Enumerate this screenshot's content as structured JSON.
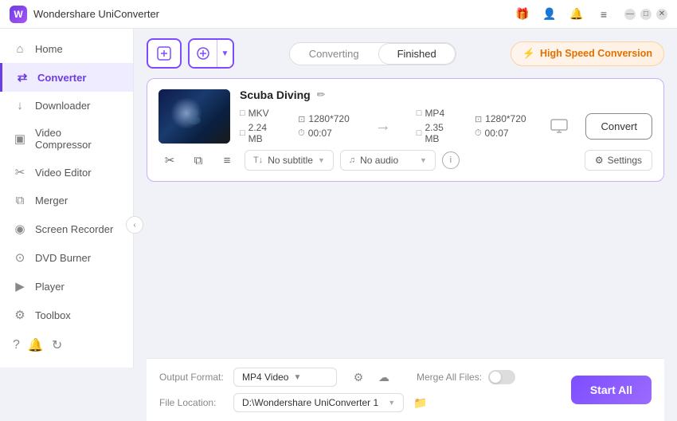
{
  "app": {
    "title": "Wondershare UniConverter",
    "logo_text": "W"
  },
  "titlebar": {
    "icons": [
      "gift",
      "user",
      "bell",
      "menu"
    ],
    "controls": [
      "minimize",
      "maximize",
      "close"
    ]
  },
  "sidebar": {
    "items": [
      {
        "id": "home",
        "label": "Home",
        "icon": "⌂"
      },
      {
        "id": "converter",
        "label": "Converter",
        "icon": "⇄",
        "active": true
      },
      {
        "id": "downloader",
        "label": "Downloader",
        "icon": "↓"
      },
      {
        "id": "video-compressor",
        "label": "Video Compressor",
        "icon": "⬛"
      },
      {
        "id": "video-editor",
        "label": "Video Editor",
        "icon": "✂"
      },
      {
        "id": "merger",
        "label": "Merger",
        "icon": "⧉"
      },
      {
        "id": "screen-recorder",
        "label": "Screen Recorder",
        "icon": "◉"
      },
      {
        "id": "dvd-burner",
        "label": "DVD Burner",
        "icon": "⊙"
      },
      {
        "id": "player",
        "label": "Player",
        "icon": "▶"
      },
      {
        "id": "toolbox",
        "label": "Toolbox",
        "icon": "⚙"
      }
    ],
    "bottom_icons": [
      "?",
      "🔔",
      "↻"
    ]
  },
  "toolbar": {
    "add_button_label": "+",
    "add_with_options_label": "+",
    "tabs": [
      {
        "id": "converting",
        "label": "Converting",
        "active": false
      },
      {
        "id": "finished",
        "label": "Finished",
        "active": true
      }
    ],
    "high_speed_label": "High Speed Conversion"
  },
  "file_card": {
    "filename": "Scuba Diving",
    "source": {
      "format": "MKV",
      "resolution": "1280*720",
      "size": "2.24 MB",
      "duration": "00:07"
    },
    "output": {
      "format": "MP4",
      "resolution": "1280*720",
      "size": "2.35 MB",
      "duration": "00:07"
    },
    "subtitle_label": "No subtitle",
    "audio_label": "No audio",
    "settings_label": "Settings",
    "convert_btn_label": "Convert"
  },
  "bottom_bar": {
    "output_format_label": "Output Format:",
    "output_format_value": "MP4 Video",
    "file_location_label": "File Location:",
    "file_location_value": "D:\\Wondershare UniConverter 1",
    "merge_files_label": "Merge All Files:",
    "start_all_label": "Start All"
  }
}
